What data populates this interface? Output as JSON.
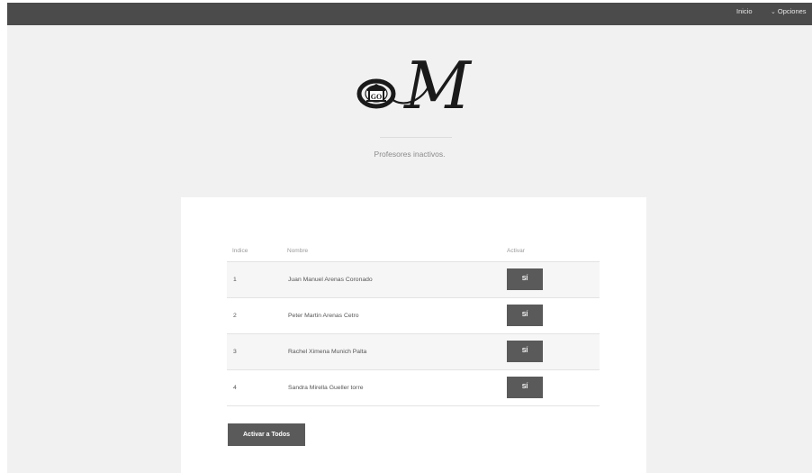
{
  "nav": {
    "inicio": "Inicio",
    "opciones": "Opciones",
    "opciones_icon": "chevron-down-icon"
  },
  "logo": {
    "letter": "M",
    "emblem_text": "GO",
    "icon": "building-emblem-icon"
  },
  "subtitle": "Profesores inactivos.",
  "table": {
    "headers": {
      "index": "Indice",
      "name": "Nombre",
      "activate": "Activar"
    },
    "rows": [
      {
        "index": "1",
        "name": "Juan Manuel Arenas Coronado",
        "button": "SÍ"
      },
      {
        "index": "2",
        "name": "Peter Martin Arenas Cetro",
        "button": "SÍ"
      },
      {
        "index": "3",
        "name": "Rachel Ximena Munich Palta",
        "button": "SÍ"
      },
      {
        "index": "4",
        "name": "Sandra Mirella Gueller torre",
        "button": "SÍ"
      }
    ]
  },
  "activate_all_label": "Activar a Todos",
  "colors": {
    "topbar": "#4b4b4b",
    "page_background": "#f1f1f1",
    "card": "#ffffff",
    "button": "#5a5a5a"
  }
}
